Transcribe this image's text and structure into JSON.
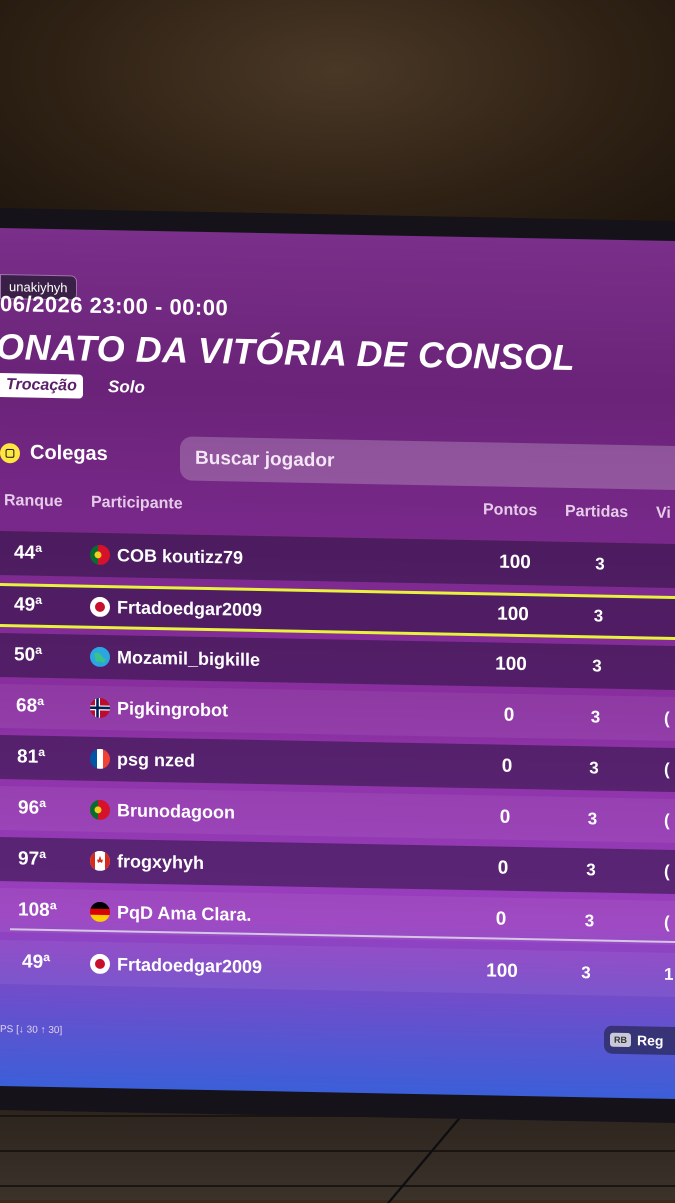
{
  "event": {
    "tag": "unakiyhyh",
    "datetime": "06/2026 23:00 - 00:00",
    "title": "ONATO DA VITÓRIA DE CONSOL",
    "mode": "Trocação",
    "type": "Solo"
  },
  "leaderboard": {
    "friends_label": "Colegas",
    "friends_icon": "circle-square-icon",
    "search_placeholder": "Buscar jogador",
    "columns": {
      "rank": "Ranque",
      "participant": "Participante",
      "points": "Pontos",
      "matches": "Partidas",
      "wins": "Vi"
    },
    "rows": [
      {
        "rank": "44ª",
        "flag": "portugal-flag",
        "name": "COB koutizz79",
        "points": "100",
        "matches": "3",
        "wins": ""
      },
      {
        "rank": "49ª",
        "flag": "japan-flag",
        "name": "Frtadoedgar2009",
        "points": "100",
        "matches": "3",
        "wins": "",
        "highlighted": true
      },
      {
        "rank": "50ª",
        "flag": "globe-flag",
        "name": "Mozamil_bigkille",
        "points": "100",
        "matches": "3",
        "wins": ""
      },
      {
        "rank": "68ª",
        "flag": "norway-flag",
        "name": "Pigkingrobot",
        "points": "0",
        "matches": "3",
        "wins": "("
      },
      {
        "rank": "81ª",
        "flag": "france-flag",
        "name": "psg nzed",
        "points": "0",
        "matches": "3",
        "wins": "("
      },
      {
        "rank": "96ª",
        "flag": "portugal-flag",
        "name": "Brunodagoon",
        "points": "0",
        "matches": "3",
        "wins": "("
      },
      {
        "rank": "97ª",
        "flag": "canada-flag",
        "name": "frogxyhyh",
        "points": "0",
        "matches": "3",
        "wins": "("
      },
      {
        "rank": "108ª",
        "flag": "germany-flag",
        "name": "PqD Ama Clara.",
        "points": "0",
        "matches": "3",
        "wins": "("
      }
    ],
    "self_row": {
      "rank": "49ª",
      "flag": "japan-flag",
      "name": "Frtadoedgar2009",
      "points": "100",
      "matches": "3",
      "wins": "1"
    }
  },
  "footer": {
    "fps": "PS [↓ 30 ↑ 30]",
    "key": "RB",
    "button_label": "Reg"
  },
  "colors": {
    "highlight": "#e8f23e",
    "friends_icon": "#ffe640"
  }
}
